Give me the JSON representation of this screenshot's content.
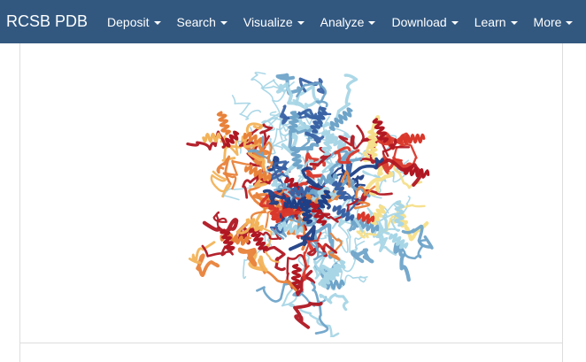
{
  "navbar": {
    "brand": "RCSB PDB",
    "color": "#325880",
    "items": [
      {
        "label": "Deposit"
      },
      {
        "label": "Search"
      },
      {
        "label": "Visualize"
      },
      {
        "label": "Analyze"
      },
      {
        "label": "Download"
      },
      {
        "label": "Learn"
      },
      {
        "label": "More"
      }
    ]
  },
  "structure_image": {
    "icon": "protein-ribbon-structure",
    "palette": [
      "#b01722",
      "#d9382b",
      "#e8823a",
      "#f2b35a",
      "#f6df8a",
      "#a8d6e6",
      "#6fa4c9",
      "#3a63a5",
      "#1f3f86"
    ]
  }
}
